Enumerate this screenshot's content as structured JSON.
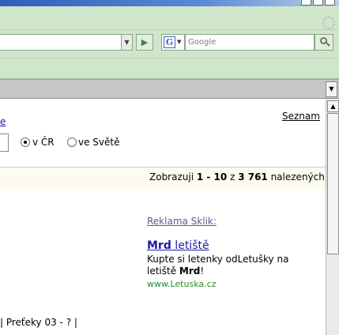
{
  "toolbar": {
    "go_glyph": "▶",
    "url_dropdown_glyph": "▼",
    "search_engine_letter": "G",
    "search_engine_dropdown_glyph": "▼",
    "search_placeholder": "Google"
  },
  "tabs": {
    "scroll_glyph": "▼"
  },
  "page": {
    "left_link_fragment": "e",
    "seznam_link": "Seznam",
    "radio_cz": {
      "label": "v ČR",
      "checked": true
    },
    "radio_world": {
      "label": "ve Světě",
      "checked": false
    },
    "results": {
      "prefix": "Zobrazuji ",
      "range": "1 - 10",
      "middle": " z ",
      "total": "3 761",
      "suffix": " nalezených"
    },
    "ad": {
      "heading": "Reklama Sklik:",
      "title_bold": "Mrd",
      "title_rest": " letiště",
      "line1": "Kupte si letenky odLetušky na",
      "line2_start": "letiště ",
      "line2_bold": "Mrd",
      "line2_end": "!",
      "url": "www.Letuska.cz"
    },
    "footer": "| Preťeky 03 - ?  |"
  },
  "scrollbar": {
    "up_glyph": "▲"
  },
  "colors": {
    "toolbar_bg": "#cfe6cb",
    "link": "#1a1aa6",
    "ad_url": "#2c8a2c",
    "results_bg": "#fdfbef"
  }
}
